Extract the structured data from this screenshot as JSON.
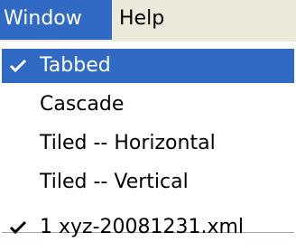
{
  "menubar": {
    "items": [
      {
        "label": "Window",
        "active": true
      },
      {
        "label": "Help",
        "active": false
      }
    ]
  },
  "window_menu": {
    "items": [
      {
        "label": "Tabbed",
        "checked": true,
        "highlighted": true
      },
      {
        "label": "Cascade",
        "checked": false,
        "highlighted": false
      },
      {
        "label": "Tiled -- Horizontal",
        "checked": false,
        "highlighted": false
      },
      {
        "label": "Tiled -- Vertical",
        "checked": false,
        "highlighted": false
      }
    ],
    "documents": [
      {
        "label": "1 xyz-20081231.xml",
        "checked": true
      }
    ]
  },
  "colors": {
    "highlight": "#316ac5",
    "menubar_bg": "#ece9d8",
    "menu_bg": "#ffffff",
    "separator": "#aca899"
  }
}
